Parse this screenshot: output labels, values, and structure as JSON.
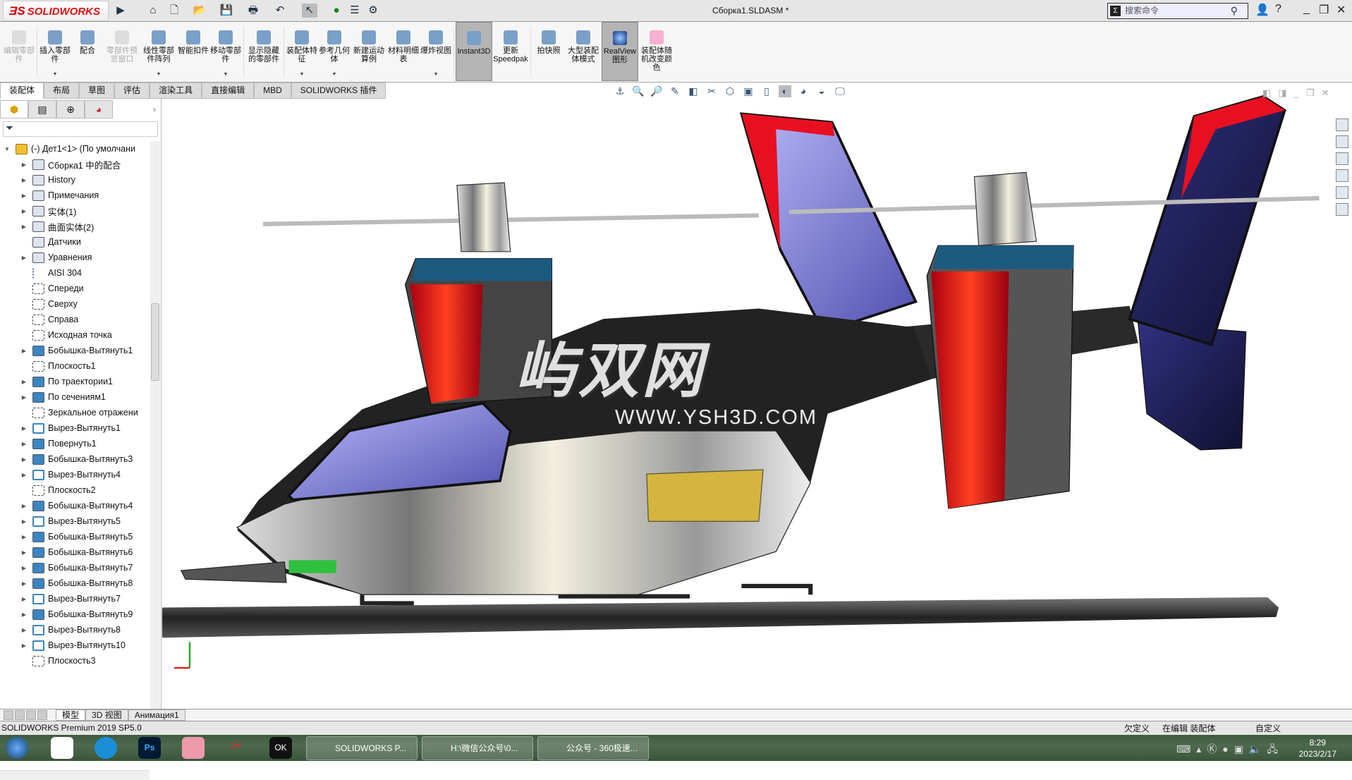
{
  "app": {
    "brand": "SOLIDWORKS",
    "doc_title": "Сборка1.SLDASM *",
    "search_placeholder": "搜索命令",
    "version": "SOLIDWORKS Premium 2019 SP5.0"
  },
  "ribbon": [
    {
      "label": "编辑零部件",
      "disabled": true
    },
    {
      "label": "插入零部件",
      "dd": true
    },
    {
      "label": "配合"
    },
    {
      "label": "零部件预览窗口",
      "disabled": true
    },
    {
      "label": "线性零部件阵列",
      "dd": true
    },
    {
      "label": "智能扣件"
    },
    {
      "label": "移动零部件",
      "dd": true
    },
    {
      "label": "显示隐藏的零部件"
    },
    {
      "label": "装配体特征",
      "dd": true
    },
    {
      "label": "参考几何体",
      "dd": true
    },
    {
      "label": "新建运动算例"
    },
    {
      "label": "材料明细表"
    },
    {
      "label": "爆炸视图",
      "dd": true
    },
    {
      "label": "Instant3D",
      "active": true
    },
    {
      "label": "更新Speedpak"
    },
    {
      "label": "拍快照"
    },
    {
      "label": "大型装配体模式"
    },
    {
      "label": "RealView图形",
      "active": true
    },
    {
      "label": "装配体随机改变颜色"
    }
  ],
  "tabs": [
    "装配体",
    "布局",
    "草图",
    "评估",
    "渲染工具",
    "直接编辑",
    "MBD",
    "SOLIDWORKS 插件"
  ],
  "tree": [
    {
      "label": "(-) Дет1<1> (По умолчани",
      "icon": "root",
      "exp": "▼"
    },
    {
      "label": "Сборка1 中的配合",
      "icon": "folder",
      "exp": "▶"
    },
    {
      "label": "History",
      "icon": "folder",
      "exp": "▶"
    },
    {
      "label": "Примечания",
      "icon": "folder",
      "exp": "▶"
    },
    {
      "label": "实体(1)",
      "icon": "folder",
      "exp": "▶"
    },
    {
      "label": "曲面实体(2)",
      "icon": "folder",
      "exp": "▶"
    },
    {
      "label": "Датчики",
      "icon": "folder",
      "exp": ""
    },
    {
      "label": "Уравнения",
      "icon": "folder",
      "exp": "▶"
    },
    {
      "label": "AISI 304",
      "icon": "mat",
      "exp": ""
    },
    {
      "label": "Спереди",
      "icon": "plane",
      "exp": ""
    },
    {
      "label": "Сверху",
      "icon": "plane",
      "exp": ""
    },
    {
      "label": "Справа",
      "icon": "plane",
      "exp": ""
    },
    {
      "label": "Исходная точка",
      "icon": "plane",
      "exp": ""
    },
    {
      "label": "Бобышка-Вытянуть1",
      "icon": "feat",
      "exp": "▶"
    },
    {
      "label": "Плоскость1",
      "icon": "plane",
      "exp": ""
    },
    {
      "label": "По траектории1",
      "icon": "feat",
      "exp": "▶"
    },
    {
      "label": "По сечениям1",
      "icon": "feat",
      "exp": "▶"
    },
    {
      "label": "Зеркальное отражени",
      "icon": "plane",
      "exp": ""
    },
    {
      "label": "Вырез-Вытянуть1",
      "icon": "cut",
      "exp": "▶"
    },
    {
      "label": "Повернуть1",
      "icon": "feat",
      "exp": "▶"
    },
    {
      "label": "Бобышка-Вытянуть3",
      "icon": "feat",
      "exp": "▶"
    },
    {
      "label": "Вырез-Вытянуть4",
      "icon": "cut",
      "exp": "▶"
    },
    {
      "label": "Плоскость2",
      "icon": "plane",
      "exp": ""
    },
    {
      "label": "Бобышка-Вытянуть4",
      "icon": "feat",
      "exp": "▶"
    },
    {
      "label": "Вырез-Вытянуть5",
      "icon": "cut",
      "exp": "▶"
    },
    {
      "label": "Бобышка-Вытянуть5",
      "icon": "feat",
      "exp": "▶"
    },
    {
      "label": "Бобышка-Вытянуть6",
      "icon": "feat",
      "exp": "▶"
    },
    {
      "label": "Бобышка-Вытянуть7",
      "icon": "feat",
      "exp": "▶"
    },
    {
      "label": "Бобышка-Вытянуть8",
      "icon": "feat",
      "exp": "▶"
    },
    {
      "label": "Вырез-Вытянуть7",
      "icon": "cut",
      "exp": "▶"
    },
    {
      "label": "Бобышка-Вытянуть9",
      "icon": "feat",
      "exp": "▶"
    },
    {
      "label": "Вырез-Вытянуть8",
      "icon": "cut",
      "exp": "▶"
    },
    {
      "label": "Вырез-Вытянуть10",
      "icon": "cut",
      "exp": "▶"
    },
    {
      "label": "Плоскость3",
      "icon": "plane",
      "exp": ""
    }
  ],
  "bottom_tabs": [
    "模型",
    "3D 视图",
    "Анимация1"
  ],
  "status": {
    "state": "欠定义",
    "editing": "在编辑 装配体",
    "units": "自定义"
  },
  "watermark": {
    "logo": "屿双网",
    "url": "WWW.YSH3D.COM"
  },
  "taskbar": {
    "windows": [
      "SOLIDWORKS P...",
      "H:\\微信公众号\\0...",
      "公众号 - 360极速..."
    ],
    "time": "8:29",
    "date": "2023/2/17"
  }
}
